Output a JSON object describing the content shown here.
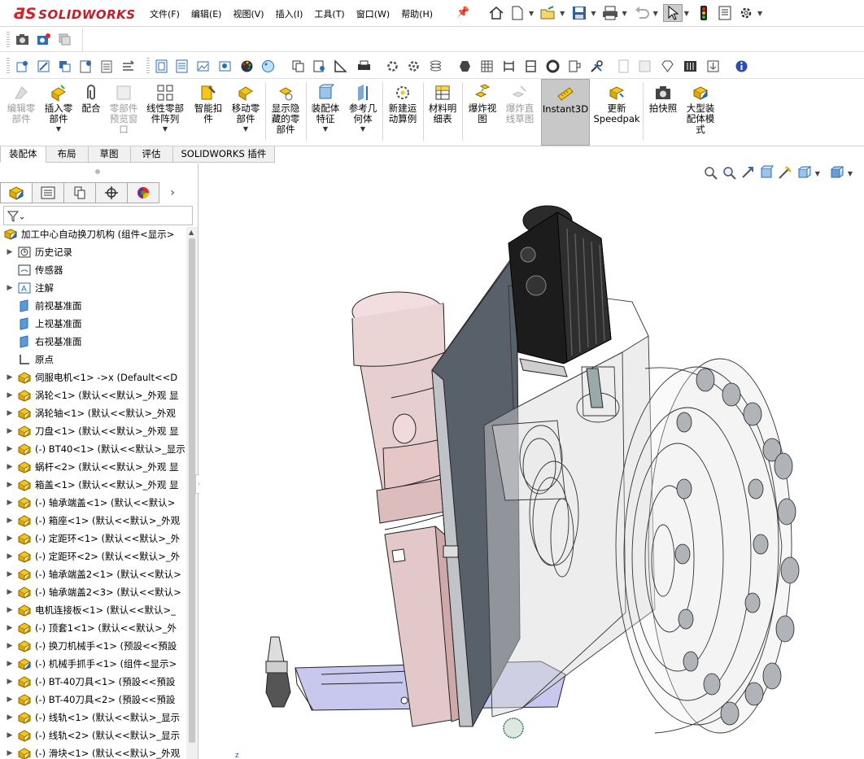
{
  "app": {
    "logo_text": "SOLIDWORKS",
    "logo_prefix": "3DS"
  },
  "menu": [
    "文件(F)",
    "编辑(E)",
    "视图(V)",
    "插入(I)",
    "工具(T)",
    "窗口(W)",
    "帮助(H)"
  ],
  "command_manager": [
    {
      "label": "编辑零\n部件",
      "disabled": true
    },
    {
      "label": "插入零\n部件",
      "disabled": false
    },
    {
      "label": "配合",
      "disabled": false
    },
    {
      "label": "零部件\n预览窗\n口",
      "disabled": true
    },
    {
      "label": "线性零部\n件阵列",
      "disabled": false
    },
    {
      "label": "智能扣\n件",
      "disabled": false
    },
    {
      "label": "移动零\n部件",
      "disabled": false
    },
    {
      "label": "显示隐\n藏的零\n部件",
      "disabled": false
    },
    {
      "label": "装配体\n特征",
      "disabled": false
    },
    {
      "label": "参考几\n何体",
      "disabled": false
    },
    {
      "label": "新建运\n动算例",
      "disabled": false
    },
    {
      "label": "材料明\n细表",
      "disabled": false
    },
    {
      "label": "爆炸视\n图",
      "disabled": false
    },
    {
      "label": "爆炸直\n线草图",
      "disabled": true
    },
    {
      "label": "Instant3D",
      "disabled": false,
      "active": true
    },
    {
      "label": "更新\nSpeedpak",
      "disabled": false
    },
    {
      "label": "拍快照",
      "disabled": false
    },
    {
      "label": "大型装\n配体模\n式",
      "disabled": false
    }
  ],
  "tabs": [
    "装配体",
    "布局",
    "草图",
    "评估",
    "SOLIDWORKS 插件"
  ],
  "tree": {
    "root": "加工中心自动换刀机构  (组件<显示>",
    "items": [
      {
        "label": "历史记录",
        "icon": "history-icon",
        "expand": true
      },
      {
        "label": "传感器",
        "icon": "sensor-icon",
        "expand": false
      },
      {
        "label": "注解",
        "icon": "annotation-icon",
        "expand": true
      },
      {
        "label": "前视基准面",
        "icon": "plane-icon",
        "expand": false
      },
      {
        "label": "上视基准面",
        "icon": "plane-icon",
        "expand": false
      },
      {
        "label": "右视基准面",
        "icon": "plane-icon",
        "expand": false
      },
      {
        "label": "原点",
        "icon": "origin-icon",
        "expand": false
      },
      {
        "label": "伺服电机<1>  ->x (Default<<D",
        "icon": "part-icon",
        "expand": true
      },
      {
        "label": "涡轮<1> (默认<<默认>_外观 显",
        "icon": "part-icon",
        "expand": true
      },
      {
        "label": "涡轮轴<1> (默认<<默认>_外观",
        "icon": "part-icon",
        "expand": true
      },
      {
        "label": "刀盘<1> (默认<<默认>_外观 显",
        "icon": "part-icon",
        "expand": true
      },
      {
        "label": "(-) BT40<1> (默认<<默认>_显示",
        "icon": "part-icon",
        "expand": true
      },
      {
        "label": "蜗杆<2> (默认<<默认>_外观 显",
        "icon": "part-icon",
        "expand": true
      },
      {
        "label": "箱盖<1> (默认<<默认>_外观 显",
        "icon": "part-icon",
        "expand": true
      },
      {
        "label": "(-) 轴承端盖<1> (默认<<默认>",
        "icon": "part-icon",
        "expand": true
      },
      {
        "label": "(-) 箱座<1> (默认<<默认>_外观",
        "icon": "part-icon",
        "expand": true
      },
      {
        "label": "(-) 定距环<1> (默认<<默认>_外",
        "icon": "part-icon",
        "expand": true
      },
      {
        "label": "(-) 定距环<2> (默认<<默认>_外",
        "icon": "part-icon",
        "expand": true
      },
      {
        "label": "(-) 轴承端盖2<1> (默认<<默认>",
        "icon": "part-icon",
        "expand": true
      },
      {
        "label": "(-) 轴承端盖2<3> (默认<<默认>",
        "icon": "part-icon",
        "expand": true
      },
      {
        "label": "电机连接板<1> (默认<<默认>_",
        "icon": "part-icon",
        "expand": true
      },
      {
        "label": "(-) 顶套1<1> (默认<<默认>_外",
        "icon": "part-icon",
        "expand": true
      },
      {
        "label": "(-) 换刀机械手<1> (预設<<預設",
        "icon": "part-icon",
        "expand": true
      },
      {
        "label": "(-) 机械手抓手<1> (组件<显示>",
        "icon": "assembly-icon",
        "expand": true
      },
      {
        "label": "(-) BT-40刀具<1> (預設<<預設",
        "icon": "part-icon",
        "expand": true
      },
      {
        "label": "(-) BT-40刀具<2> (預設<<預設",
        "icon": "part-icon",
        "expand": true
      },
      {
        "label": "(-) 线轨<1> (默认<<默认>_显示",
        "icon": "part-icon",
        "expand": true
      },
      {
        "label": "(-) 线轨<2> (默认<<默认>_显示",
        "icon": "part-icon",
        "expand": true
      },
      {
        "label": "(-) 滑块<1> (默认<<默认>_外观",
        "icon": "part-icon",
        "expand": true
      }
    ]
  },
  "colors": {
    "brand": "#da1f26",
    "accent": "#2a6ebb",
    "part": "#e8b400",
    "active_tool": "#c8c8c8"
  }
}
